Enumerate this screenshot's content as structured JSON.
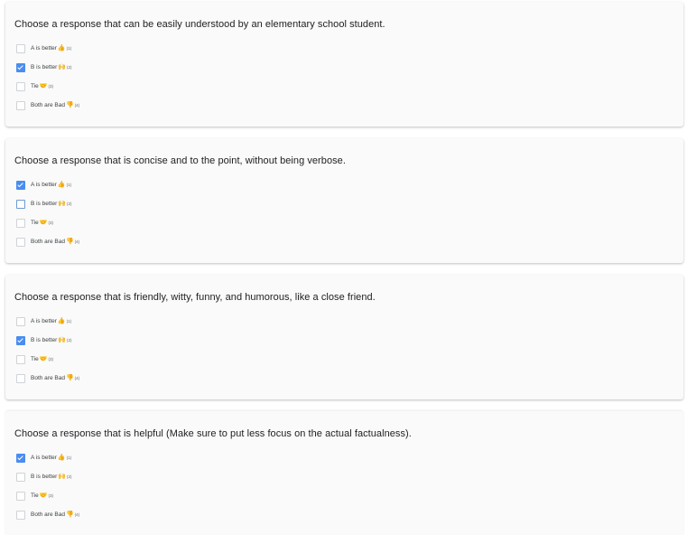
{
  "questions": [
    {
      "text": "Choose a response that can be easily understood by an elementary school student.",
      "options": [
        {
          "label": "A is better",
          "emoji": "👍",
          "key": "(1)",
          "checked": false
        },
        {
          "label": "B is better",
          "emoji": "🙌",
          "key": "(2)",
          "checked": true
        },
        {
          "label": "Tie",
          "emoji": "🤝",
          "key": "(3)",
          "checked": false
        },
        {
          "label": "Both are Bad",
          "emoji": "👎",
          "key": "(4)",
          "checked": false
        }
      ]
    },
    {
      "text": "Choose a response that is concise and to the point, without being verbose.",
      "options": [
        {
          "label": "A is better",
          "emoji": "👍",
          "key": "(1)",
          "checked": true
        },
        {
          "label": "B is better",
          "emoji": "🙌",
          "key": "(2)",
          "checked": false,
          "focused": true
        },
        {
          "label": "Tie",
          "emoji": "🤝",
          "key": "(3)",
          "checked": false
        },
        {
          "label": "Both are Bad",
          "emoji": "👎",
          "key": "(4)",
          "checked": false
        }
      ]
    },
    {
      "text": "Choose a response that is friendly, witty, funny, and humorous, like a close friend.",
      "options": [
        {
          "label": "A is better",
          "emoji": "👍",
          "key": "(1)",
          "checked": false
        },
        {
          "label": "B is better",
          "emoji": "🙌",
          "key": "(2)",
          "checked": true
        },
        {
          "label": "Tie",
          "emoji": "🤝",
          "key": "(3)",
          "checked": false
        },
        {
          "label": "Both are Bad",
          "emoji": "👎",
          "key": "(4)",
          "checked": false
        }
      ]
    },
    {
      "text": "Choose a response that is helpful (Make sure to put less focus on the actual factualness).",
      "options": [
        {
          "label": "A is better",
          "emoji": "👍",
          "key": "(1)",
          "checked": true
        },
        {
          "label": "B is better",
          "emoji": "🙌",
          "key": "(2)",
          "checked": false
        },
        {
          "label": "Tie",
          "emoji": "🤝",
          "key": "(3)",
          "checked": false
        },
        {
          "label": "Both are Bad",
          "emoji": "👎",
          "key": "(4)",
          "checked": false
        }
      ]
    }
  ],
  "colors": {
    "checked": "#4a8df0",
    "card_background": "#fafafa"
  }
}
